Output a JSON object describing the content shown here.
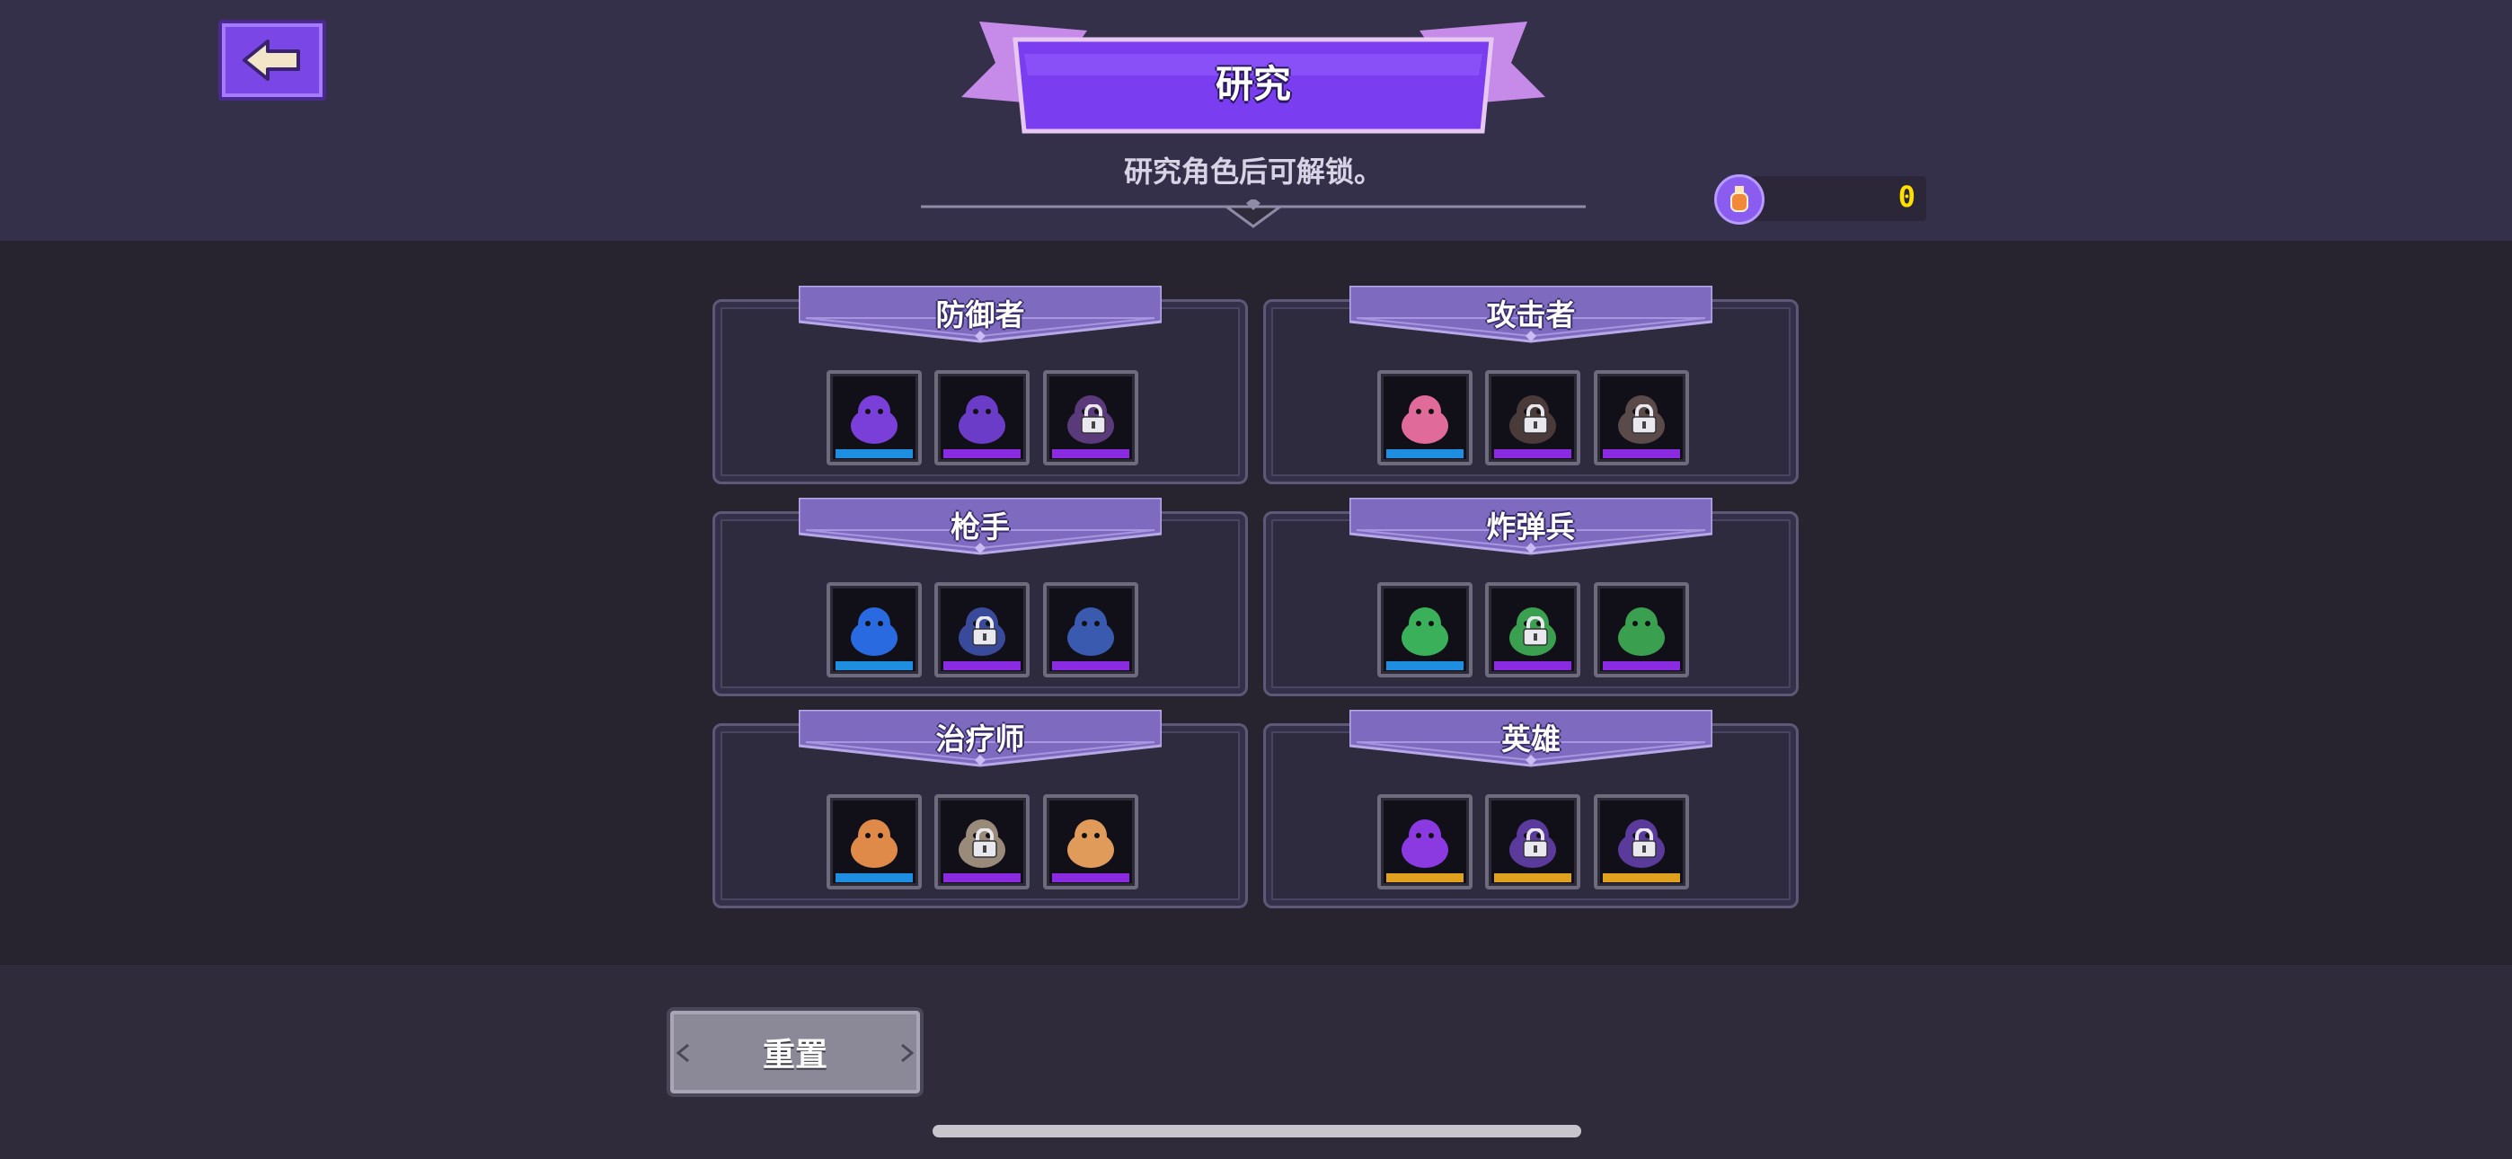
{
  "header": {
    "title": "研究",
    "subtitle": "研究角色后可解锁。",
    "currency_value": "0",
    "currency_icon": "research-potion-icon"
  },
  "categories": [
    {
      "name": "防御者",
      "units": [
        {
          "locked": false,
          "tier": "blue"
        },
        {
          "locked": false,
          "tier": "purple"
        },
        {
          "locked": true,
          "tier": "purple"
        }
      ]
    },
    {
      "name": "攻击者",
      "units": [
        {
          "locked": false,
          "tier": "blue"
        },
        {
          "locked": true,
          "tier": "purple"
        },
        {
          "locked": true,
          "tier": "purple"
        }
      ]
    },
    {
      "name": "枪手",
      "units": [
        {
          "locked": false,
          "tier": "blue"
        },
        {
          "locked": true,
          "tier": "purple"
        },
        {
          "locked": false,
          "tier": "purple"
        }
      ]
    },
    {
      "name": "炸弹兵",
      "units": [
        {
          "locked": false,
          "tier": "blue"
        },
        {
          "locked": true,
          "tier": "purple"
        },
        {
          "locked": false,
          "tier": "purple"
        }
      ]
    },
    {
      "name": "治疗师",
      "units": [
        {
          "locked": false,
          "tier": "blue"
        },
        {
          "locked": true,
          "tier": "purple"
        },
        {
          "locked": false,
          "tier": "purple"
        }
      ]
    },
    {
      "name": "英雄",
      "units": [
        {
          "locked": false,
          "tier": "gold"
        },
        {
          "locked": true,
          "tier": "gold"
        },
        {
          "locked": true,
          "tier": "gold"
        }
      ]
    }
  ],
  "footer": {
    "reset_label": "重置"
  },
  "colors": {
    "blue": "#1e8fe0",
    "purple": "#8a2be2",
    "gold": "#e0a21e",
    "accent": "#7b46e6"
  }
}
